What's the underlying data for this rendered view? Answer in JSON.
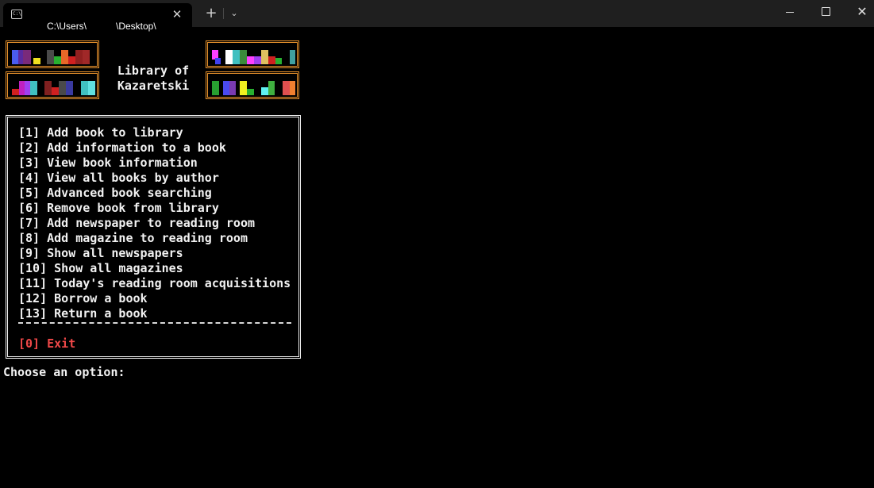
{
  "window": {
    "tab_title_part1": "C:\\Users\\",
    "tab_title_part2": "\\Desktop\\",
    "tab_icon_text": "C:\\",
    "tab_close_glyph": "✕",
    "new_tab_glyph": "+",
    "dropdown_glyph": "⌄",
    "minimize_icon": "minimize-icon",
    "maximize_icon": "maximize-icon",
    "close_glyph": "✕"
  },
  "banner": {
    "title_line1": "Library of",
    "title_line2": "Kazaretski",
    "frame_color": "#e8922c"
  },
  "menu": {
    "items": [
      "[1] Add book to library",
      "[2] Add information to a book",
      "[3] View book information",
      "[4] View all books by author",
      "[5] Advanced book searching",
      "[6] Remove book from library",
      "[7] Add newspaper to reading room",
      "[8] Add magazine to reading room",
      "[9] Show all newspapers",
      "[10] Show all magazines",
      "[11] Today's reading room acquisitions",
      "[12] Borrow a book",
      "[13] Return a book"
    ],
    "exit_label": "[0] Exit",
    "exit_color": "#f04848"
  },
  "prompt": {
    "text": "Choose an option:"
  },
  "colors": {
    "background": "#000000",
    "text": "#f2f2f2",
    "titlebar": "#1f1f1f"
  }
}
